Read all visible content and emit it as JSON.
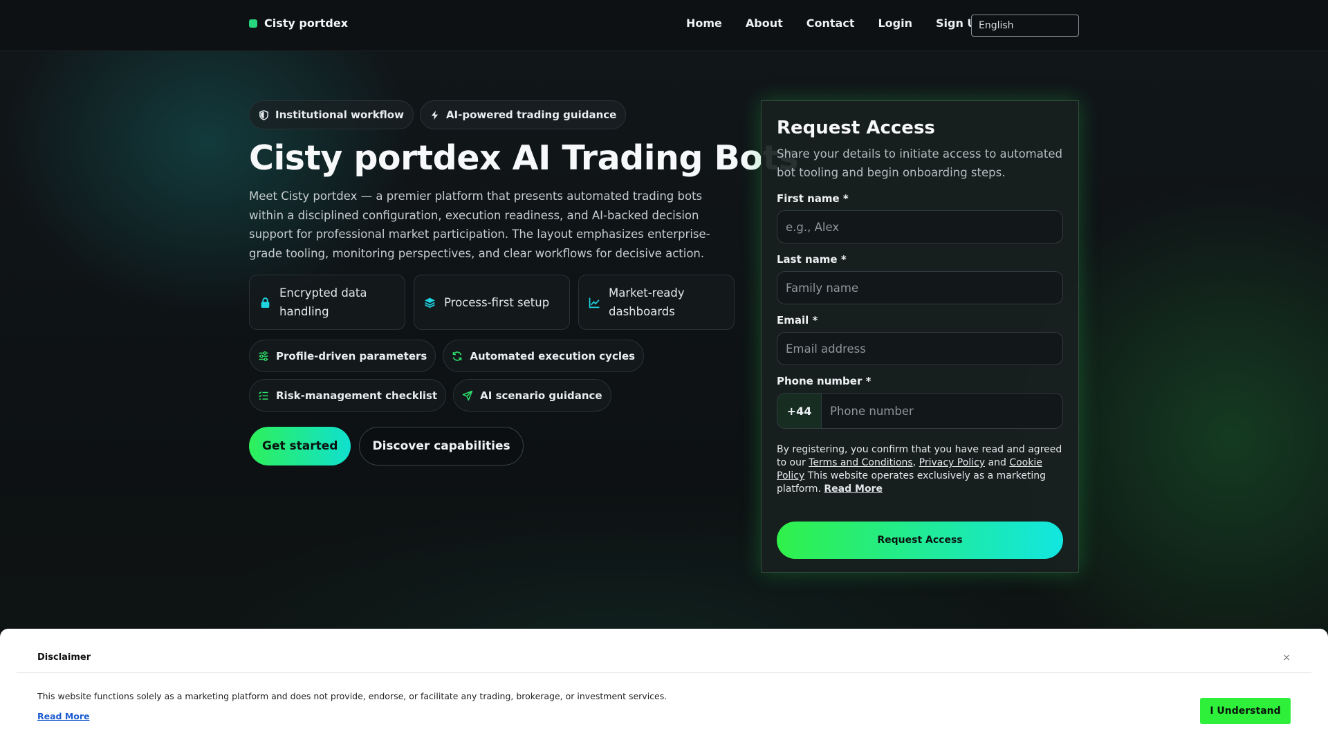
{
  "colors": {
    "accent_green": "#27d77d",
    "gradient_start": "#2ef05a",
    "gradient_end": "#10e0cf",
    "page_bg": "#0d1012",
    "disclaimer_bg": "#ffffff",
    "link_blue": "#1a5ccf"
  },
  "nav": {
    "brand": "Cisty portdex",
    "links": [
      "Home",
      "About",
      "Contact",
      "Login",
      "Sign Up"
    ],
    "language": "English"
  },
  "hero": {
    "badges": [
      {
        "label": "Institutional workflow",
        "icon": "shield-icon"
      },
      {
        "label": "AI-powered trading guidance",
        "icon": "bolt-icon"
      }
    ],
    "title": "Cisty portdex AI Trading Bots",
    "description": "Meet Cisty portdex — a premier platform that presents automated trading bots within a disciplined configuration, execution readiness, and AI-backed decision support for professional market participation. The layout emphasizes enterprise-grade tooling, monitoring perspectives, and clear workflows for decisive action.",
    "features": [
      {
        "label": "Encrypted data handling",
        "icon": "lock-icon"
      },
      {
        "label": "Process-first setup",
        "icon": "layers-icon"
      },
      {
        "label": "Market-ready dashboards",
        "icon": "chart-line-icon"
      }
    ],
    "tags_row1": [
      {
        "label": "Profile-driven parameters",
        "icon": "sliders-icon"
      },
      {
        "label": "Automated execution cycles",
        "icon": "refresh-icon"
      }
    ],
    "tags_row2": [
      {
        "label": "Risk-management checklist",
        "icon": "checklist-icon"
      },
      {
        "label": "AI scenario guidance",
        "icon": "send-icon"
      }
    ],
    "cta_primary": "Get started",
    "cta_secondary": "Discover capabilities"
  },
  "form": {
    "title": "Request Access",
    "subtitle": "Share your details to initiate access to automated bot tooling and begin onboarding steps.",
    "first_name_label": "First name *",
    "first_name_placeholder": "e.g., Alex",
    "last_name_label": "Last name *",
    "last_name_placeholder": "Family name",
    "email_label": "Email *",
    "email_placeholder": "Email address",
    "phone_label": "Phone number *",
    "phone_code": "+44",
    "phone_placeholder": "Phone number",
    "consent_pre": "By registering, you confirm that you have read and agreed to our ",
    "terms": "Terms and Conditions",
    "comma": ", ",
    "privacy": "Privacy Policy",
    "and": " and ",
    "cookie": "Cookie Policy",
    "consent_post": " This website operates exclusively as a marketing platform. ",
    "read_more": "Read More",
    "submit": "Request Access"
  },
  "disclaimer": {
    "title": "Disclaimer",
    "close": "×",
    "text": "This website functions solely as a marketing platform and does not provide, endorse, or facilitate any trading, brokerage, or investment services.",
    "read_more": "Read More",
    "button": "I Understand"
  }
}
